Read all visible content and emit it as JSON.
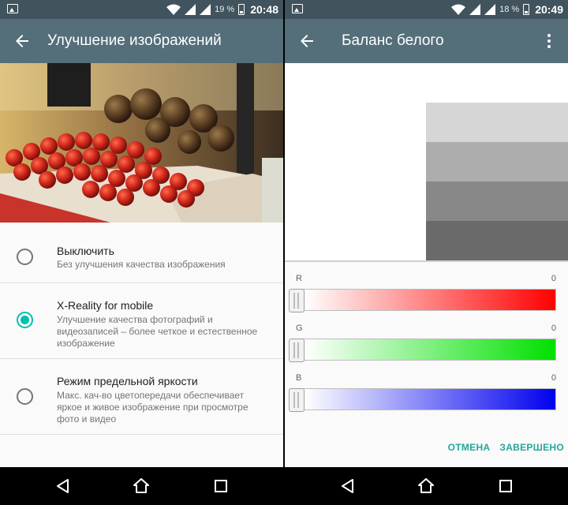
{
  "left": {
    "status": {
      "battery_pct": "19 %",
      "time": "20:48"
    },
    "appbar": {
      "title": "Улучшение изображений"
    },
    "options": [
      {
        "title": "Выключить",
        "desc": "Без улучшения качества изображения",
        "checked": false
      },
      {
        "title": "X-Reality for mobile",
        "desc": "Улучшение качества фотографий и видеозаписей – более четкое и естественное изображение",
        "checked": true
      },
      {
        "title": "Режим предельной яркости",
        "desc": "Макс. кач-во цветопередачи обеспечивает яркое и живое изображение при просмотре фото и видео",
        "checked": false
      }
    ]
  },
  "right": {
    "status": {
      "battery_pct": "18 %",
      "time": "20:49"
    },
    "appbar": {
      "title": "Баланс белого"
    },
    "sliders": [
      {
        "label": "R",
        "value": "0"
      },
      {
        "label": "G",
        "value": "0"
      },
      {
        "label": "B",
        "value": "0"
      }
    ],
    "actions": {
      "cancel": "ОТМЕНА",
      "done": "ЗАВЕРШЕНО"
    }
  },
  "colors": {
    "statusbar": "#41535d",
    "appbar": "#546e7a",
    "accent": "#00bfae",
    "action": "#26a69a"
  },
  "icons": [
    "image-notification-icon",
    "wifi-icon",
    "signal-icon",
    "battery-icon",
    "back-arrow-icon",
    "more-vert-icon",
    "nav-back-icon",
    "nav-home-icon",
    "nav-recent-icon"
  ]
}
